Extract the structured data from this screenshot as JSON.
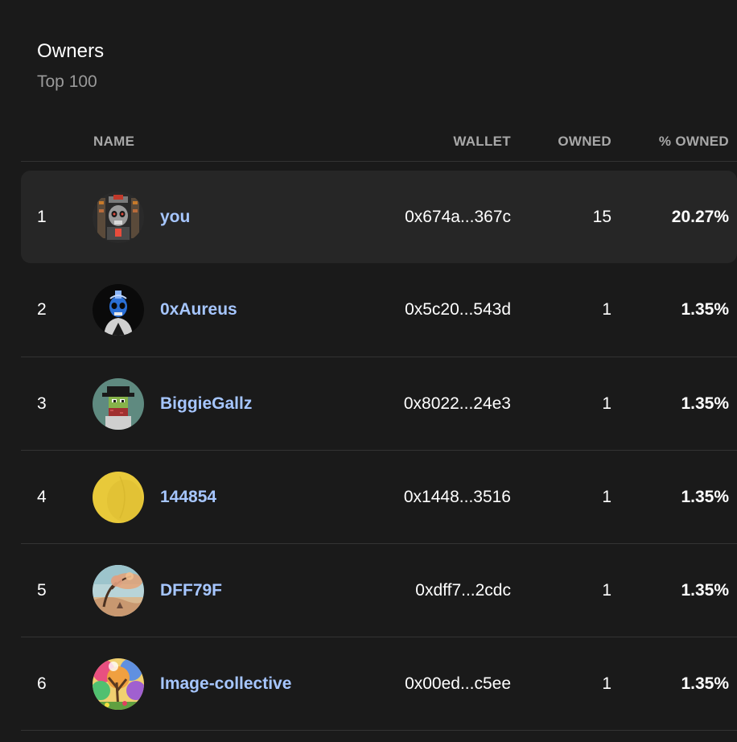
{
  "panel": {
    "title": "Owners",
    "subtitle": "Top 100"
  },
  "table": {
    "columns": {
      "name": "NAME",
      "wallet": "WALLET",
      "owned": "OWNED",
      "pct": "% OWNED"
    },
    "rows": [
      {
        "rank": "1",
        "name": "you",
        "wallet": "0x674a...367c",
        "owned": "15",
        "pct": "20.27%",
        "avatar": "skull-machine-avatar"
      },
      {
        "rank": "2",
        "name": "0xAureus",
        "wallet": "0x5c20...543d",
        "owned": "1",
        "pct": "1.35%",
        "avatar": "blue-skull-avatar"
      },
      {
        "rank": "3",
        "name": "BiggieGallz",
        "wallet": "0x8022...24e3",
        "owned": "1",
        "pct": "1.35%",
        "avatar": "pixel-hat-avatar"
      },
      {
        "rank": "4",
        "name": "144854",
        "wallet": "0x1448...3516",
        "owned": "1",
        "pct": "1.35%",
        "avatar": "yellow-circle-avatar"
      },
      {
        "rank": "5",
        "name": "DFF79F",
        "wallet": "0xdff7...2cdc",
        "owned": "1",
        "pct": "1.35%",
        "avatar": "landscape-tree-avatar"
      },
      {
        "rank": "6",
        "name": "Image-collective",
        "wallet": "0x00ed...c5ee",
        "owned": "1",
        "pct": "1.35%",
        "avatar": "colorful-tree-avatar"
      }
    ]
  },
  "colors": {
    "background": "#1a1a1a",
    "highlight_row": "#262626",
    "link": "#a6c6ff",
    "muted": "#9a9a9a",
    "divider": "#333333"
  }
}
